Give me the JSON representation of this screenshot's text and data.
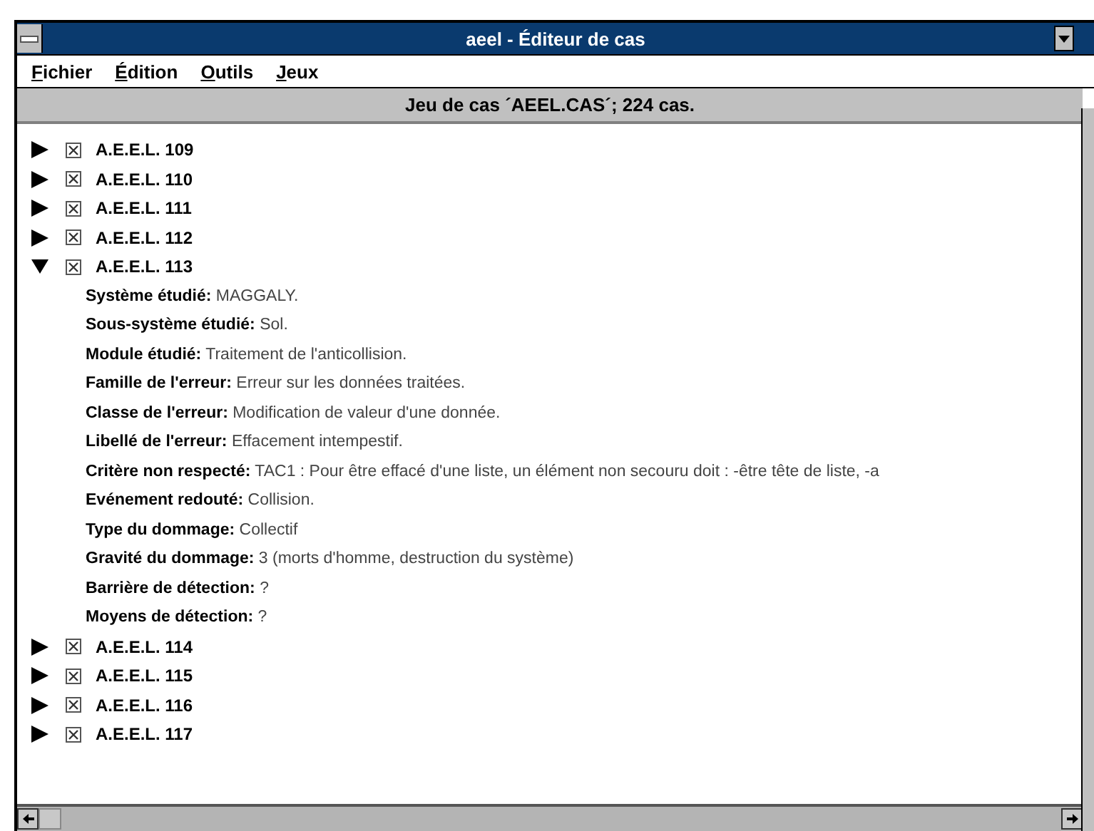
{
  "window": {
    "title": "aeel - Éditeur de cas"
  },
  "menu": [
    {
      "label": "Fichier"
    },
    {
      "label": "Édition"
    },
    {
      "label": "Outils"
    },
    {
      "label": "Jeux"
    }
  ],
  "header": "Jeu de cas ´AEEL.CAS´; 224 cas.",
  "cases": [
    {
      "label": "A.E.E.L. 109",
      "expanded": false,
      "checked": true
    },
    {
      "label": "A.E.E.L. 110",
      "expanded": false,
      "checked": true
    },
    {
      "label": "A.E.E.L. 111",
      "expanded": false,
      "checked": true
    },
    {
      "label": "A.E.E.L. 112",
      "expanded": false,
      "checked": true
    },
    {
      "label": "A.E.E.L. 113",
      "expanded": true,
      "checked": true,
      "details": [
        "**Système étudié:** MAGGALY.",
        "**Sous-système étudié:** Sol.",
        "**Module étudié:** Traitement de l'anticollision.",
        "**Famille de l'erreur:** Erreur sur les données traitées.",
        "**Classe de l'erreur:** Modification de valeur d'une donnée.",
        "**Libellé de l'erreur:** Effacement intempestif.",
        "**Critère non respecté:** TAC1 : Pour être effacé d'une liste, un élément non secouru doit : -être tête de liste, -a",
        "**Evénement redouté:** Collision.",
        "**Type du dommage:** Collectif",
        "**Gravité du dommage:** 3 (morts d'homme, destruction du système)",
        "**Barrière de détection:** ?",
        "**Moyens de détection:** ?"
      ]
    },
    {
      "label": "A.E.E.L. 114",
      "expanded": false,
      "checked": true
    },
    {
      "label": "A.E.E.L. 115",
      "expanded": false,
      "checked": true
    },
    {
      "label": "A.E.E.L. 116",
      "expanded": false,
      "checked": true
    },
    {
      "label": "A.E.E.L. 117",
      "expanded": false,
      "checked": true
    }
  ]
}
